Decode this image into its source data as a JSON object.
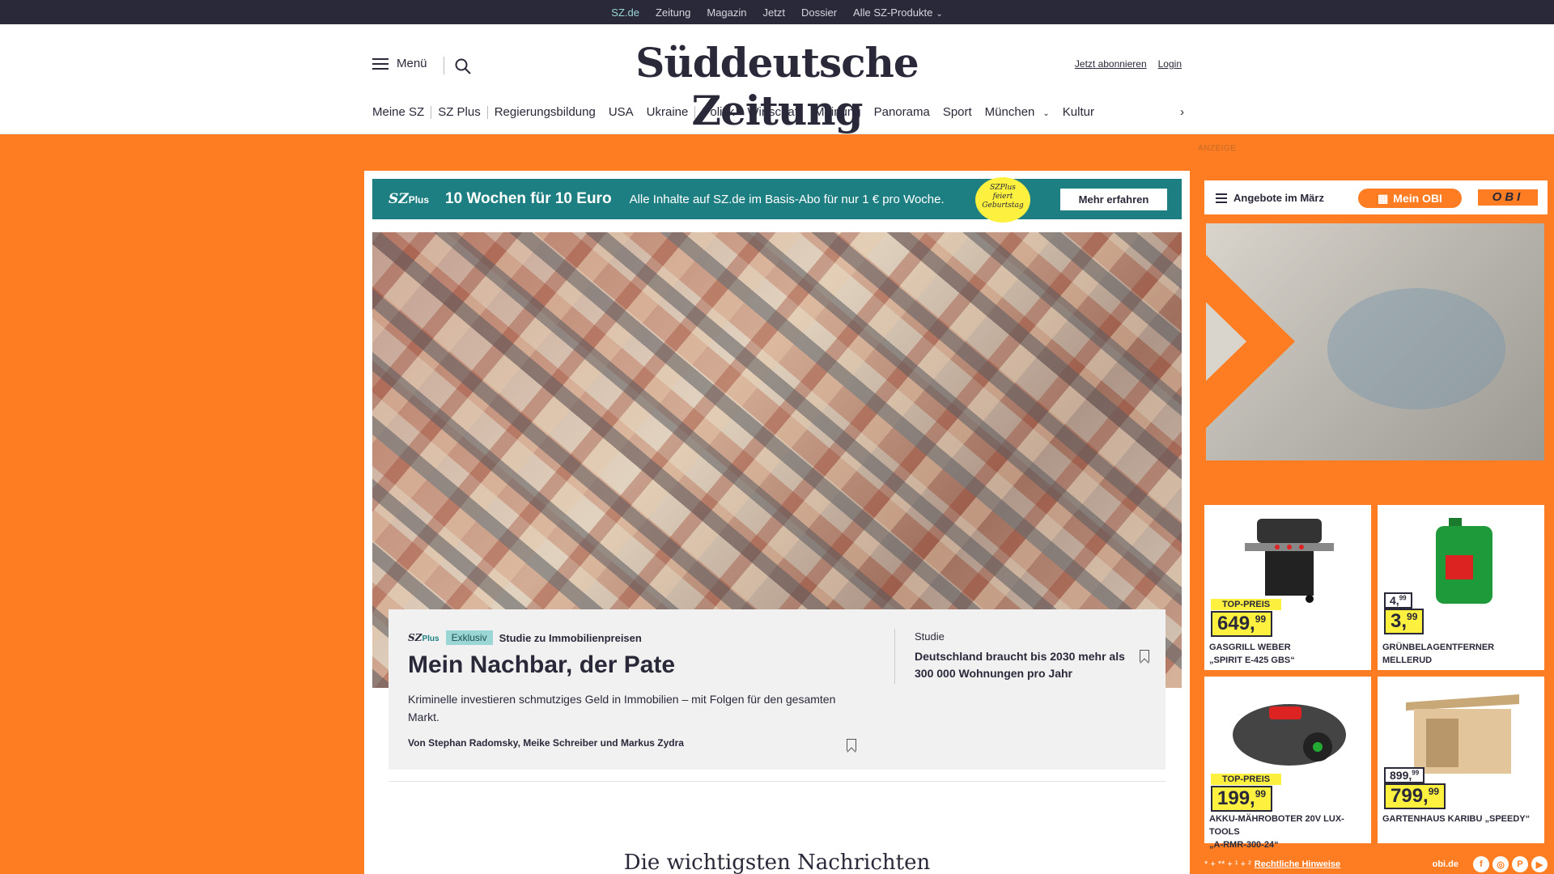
{
  "topbar": {
    "links": [
      "SZ.de",
      "Zeitung",
      "Magazin",
      "Jetzt",
      "Dossier",
      "Alle SZ-Produkte"
    ]
  },
  "header": {
    "menu_label": "Menü",
    "logo": "Süddeutsche Zeitung",
    "subscribe": "Jetzt abonnieren",
    "login": "Login"
  },
  "nav": {
    "items": [
      "Meine SZ",
      "SZ Plus",
      "Regierungsbildung",
      "USA",
      "Ukraine",
      "Politik",
      "Wirtschaft",
      "Meinung",
      "Panorama",
      "Sport",
      "München",
      "Kultur"
    ]
  },
  "promo": {
    "brand": "SZ",
    "brand_plus": "Plus",
    "headline": "10 Wochen für 10 Euro",
    "text": "Alle Inhalte auf SZ.de im Basis-Abo für nur 1 € pro Woche.",
    "badge_brand": "SZPlus",
    "badge_line1": "feiert",
    "badge_line2": "Geburtstag",
    "button": "Mehr erfahren"
  },
  "lead": {
    "brand": "SZ",
    "brand_plus": "Plus",
    "badge": "Exklusiv",
    "kicker": "Studie zu Immobilienpreisen",
    "title": "Mein Nachbar, der Pate",
    "teaser": "Kriminelle investieren schmutziges Geld in Immobilien – mit Folgen für den gesamten Markt.",
    "authors": "Von Stephan Radomsky, Meike Schreiber und Markus Zydra",
    "side_kicker": "Studie",
    "side_title": "Deutschland braucht bis 2030 mehr als 300 000 Wohnungen pro Jahr"
  },
  "section": {
    "title": "Die wichtigsten Nachrichten"
  },
  "ad": {
    "label": "ANZEIGE",
    "bar_title": "Angebote im März",
    "my_obi": "Mein OBI",
    "obi_logo": "OBI",
    "products": [
      {
        "name_line1": "GASGRILL WEBER",
        "name_line2": "„SPIRIT E-425 GBS“",
        "top_label": "TOP-PREIS",
        "price": "649,",
        "cents": "99",
        "old_price": "",
        "old_cents": ""
      },
      {
        "name_line1": "GRÜNBELAGENTFERNER",
        "name_line2": "MELLERUD",
        "top_label": "",
        "price": "3,",
        "cents": "99",
        "old_price": "4,",
        "old_cents": "99"
      },
      {
        "name_line1": "AKKU-MÄHROBOTER 20V LUX-TOOLS",
        "name_line2": "„A-RMR-300-24“",
        "top_label": "TOP-PREIS",
        "price": "199,",
        "cents": "99",
        "old_price": "",
        "old_cents": ""
      },
      {
        "name_line1": "GARTENHAUS KARIBU „SPEEDY“",
        "name_line2": "",
        "top_label": "",
        "price": "799,",
        "cents": "99",
        "old_price": "899,",
        "old_cents": "99"
      }
    ],
    "footer_notes": "* + ** + ¹ + ²",
    "footer_link": "Rechtliche Hinweise",
    "footer_domain": "obi.de",
    "social": [
      "f",
      "◎",
      "P",
      "▶"
    ]
  },
  "colors": {
    "brand_dark": "#29293a",
    "sz_teal": "#1e7f82",
    "obi_orange": "#ff7d22",
    "price_yellow": "#fdf03e"
  }
}
